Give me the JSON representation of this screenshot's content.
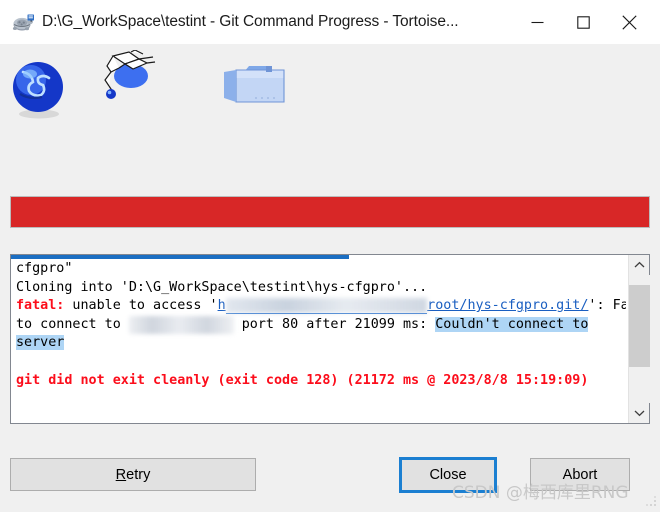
{
  "window": {
    "title": "D:\\G_WorkSpace\\testint - Git Command Progress - Tortoise...",
    "icon": "tortoise-git-icon",
    "minimize_label": "Minimize",
    "maximize_label": "Maximize",
    "close_label": "Close"
  },
  "animation": {
    "source_icon": "globe-icon",
    "transfer_icon": "flying-documents-icon",
    "target_icon": "folder-icon"
  },
  "progress": {
    "state": "error",
    "percent": 100,
    "fill_color": "#d82727",
    "border_color": "#bcbcbc"
  },
  "log": {
    "hscroll_percent": 53,
    "vscroll_thumb_top_percent": 8,
    "vscroll_thumb_height_percent": 64,
    "lines": [
      {
        "id": "line-1",
        "segments": [
          {
            "text": "cfgpro\"",
            "style": "plain"
          }
        ]
      },
      {
        "id": "line-2",
        "segments": [
          {
            "text": "Cloning into 'D:\\G_WorkSpace\\testint\\hys-cfgpro'...",
            "style": "plain"
          }
        ]
      },
      {
        "id": "line-3",
        "segments": [
          {
            "text": "fatal:",
            "style": "fatal"
          },
          {
            "text": " unable to access '",
            "style": "plain"
          },
          {
            "text": "h",
            "style": "url"
          },
          {
            "text": "ttp://192.168.x.xxx:xxxx/",
            "style": "redacted-url"
          },
          {
            "text": "root/hys-cfgpro.git/",
            "style": "url"
          },
          {
            "text": "': Failed",
            "style": "plain"
          }
        ]
      },
      {
        "id": "line-4",
        "segments": [
          {
            "text": "to connect to ",
            "style": "plain"
          },
          {
            "text": "192.168.x.xxx",
            "style": "redacted"
          },
          {
            "text": " port 80 after 21099 ms: ",
            "style": "plain"
          },
          {
            "text": "Couldn't connect to",
            "style": "selected"
          }
        ]
      },
      {
        "id": "line-5",
        "segments": [
          {
            "text": "server",
            "style": "selected"
          }
        ]
      },
      {
        "id": "line-6",
        "segments": []
      },
      {
        "id": "line-7",
        "segments": [
          {
            "text": "git did not exit cleanly (exit code 128) (21172 ms @ 2023/8/8 15:19:09)",
            "style": "error"
          }
        ]
      }
    ]
  },
  "buttons": {
    "retry": {
      "label": "Retry",
      "accel": "R",
      "focused": false
    },
    "close": {
      "label": "Close",
      "accel": "",
      "focused": true
    },
    "abort": {
      "label": "Abort",
      "accel": "",
      "focused": false
    }
  },
  "watermark": {
    "text": "CSDN @梅西库里RNG",
    "color": "#c8c8c8"
  }
}
